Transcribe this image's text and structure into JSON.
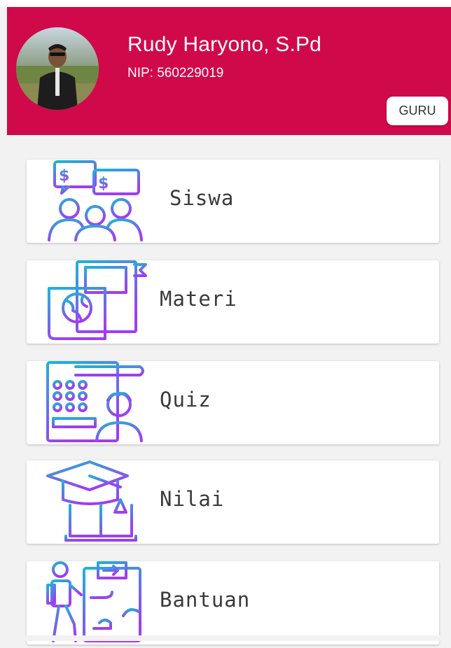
{
  "profile": {
    "name": "Rudy Haryono, S.Pd",
    "nip": "NIP: 560229019",
    "role": "GURU"
  },
  "menu": {
    "items": [
      {
        "label": "Siswa",
        "icon": "students-chat-icon"
      },
      {
        "label": "Materi",
        "icon": "books-globe-icon"
      },
      {
        "label": "Quiz",
        "icon": "quiz-calendar-student-icon"
      },
      {
        "label": "Nilai",
        "icon": "graduation-cap-book-icon"
      },
      {
        "label": "Bantuan",
        "icon": "help-hiker-map-icon"
      }
    ]
  },
  "colors": {
    "header": "#d0094a",
    "icon_gradient_start": "#1fb3d9",
    "icon_gradient_end": "#a13df0"
  }
}
